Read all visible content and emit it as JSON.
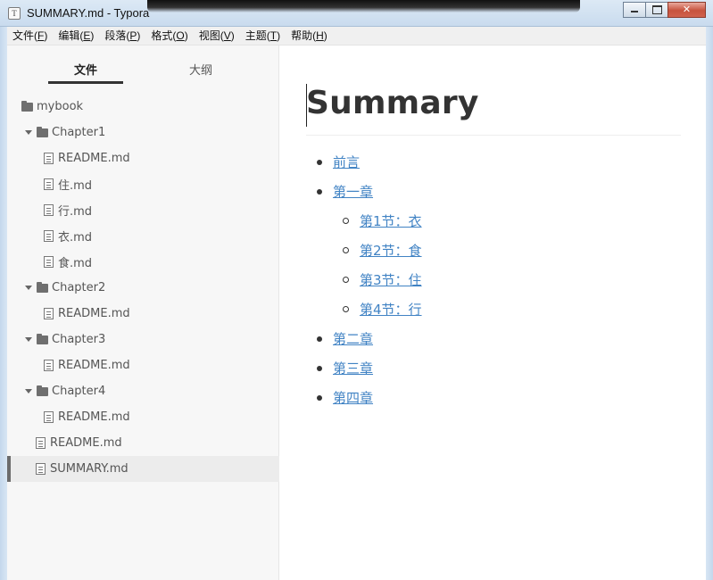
{
  "window": {
    "title": "SUMMARY.md - Typora",
    "app_icon_letter": "T"
  },
  "menu": [
    {
      "label": "文件(",
      "key": "F",
      "end": ")"
    },
    {
      "label": "编辑(",
      "key": "E",
      "end": ")"
    },
    {
      "label": "段落(",
      "key": "P",
      "end": ")"
    },
    {
      "label": "格式(",
      "key": "O",
      "end": ")"
    },
    {
      "label": "视图(",
      "key": "V",
      "end": ")"
    },
    {
      "label": "主题(",
      "key": "T",
      "end": ")"
    },
    {
      "label": "帮助(",
      "key": "H",
      "end": ")"
    }
  ],
  "sidebar": {
    "tabs": [
      "文件",
      "大纲"
    ],
    "tree": [
      {
        "label": "mybook",
        "type": "folder",
        "depth": 0,
        "caret": false
      },
      {
        "label": "Chapter1",
        "type": "folder",
        "depth": 1,
        "caret": true
      },
      {
        "label": "README.md",
        "type": "file",
        "depth": 2
      },
      {
        "label": "住.md",
        "type": "file",
        "depth": 2
      },
      {
        "label": "行.md",
        "type": "file",
        "depth": 2
      },
      {
        "label": "衣.md",
        "type": "file",
        "depth": 2
      },
      {
        "label": "食.md",
        "type": "file",
        "depth": 2
      },
      {
        "label": "Chapter2",
        "type": "folder",
        "depth": 1,
        "caret": true
      },
      {
        "label": "README.md",
        "type": "file",
        "depth": 2
      },
      {
        "label": "Chapter3",
        "type": "folder",
        "depth": 1,
        "caret": true
      },
      {
        "label": "README.md",
        "type": "file",
        "depth": 2
      },
      {
        "label": "Chapter4",
        "type": "folder",
        "depth": 1,
        "caret": true
      },
      {
        "label": "README.md",
        "type": "file",
        "depth": 2
      },
      {
        "label": "README.md",
        "type": "file",
        "depth": 1
      },
      {
        "label": "SUMMARY.md",
        "type": "file",
        "depth": 1,
        "active": true
      }
    ]
  },
  "document": {
    "heading": "Summary",
    "list": [
      {
        "text": "前言",
        "level": 0
      },
      {
        "text": "第一章",
        "level": 0
      },
      {
        "text": "第1节：衣",
        "level": 1
      },
      {
        "text": "第2节：食",
        "level": 1
      },
      {
        "text": "第3节：住",
        "level": 1
      },
      {
        "text": "第4节：行",
        "level": 1
      },
      {
        "text": "第二章",
        "level": 0
      },
      {
        "text": "第三章",
        "level": 0
      },
      {
        "text": "第四章",
        "level": 0
      }
    ]
  },
  "colors": {
    "link": "#4183c4",
    "active_marker": "#6b6b6b"
  }
}
